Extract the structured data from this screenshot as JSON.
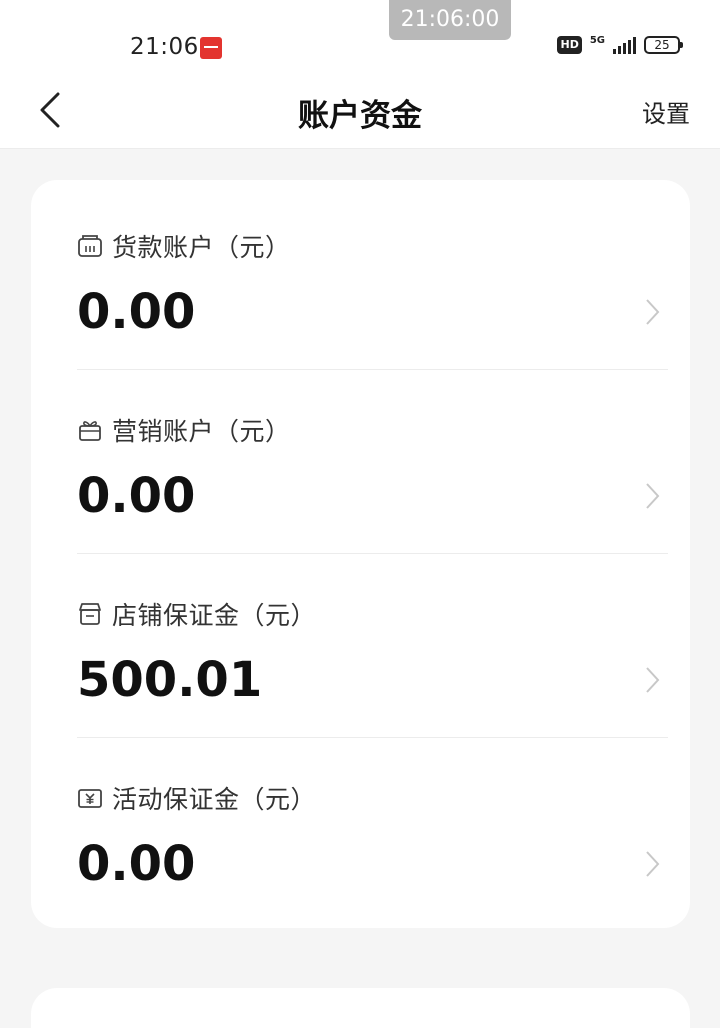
{
  "status_bar": {
    "time": "21:06",
    "overlay_time": "21:06:00",
    "hd": "HD",
    "network": "5G",
    "battery": "25"
  },
  "header": {
    "title": "账户资金",
    "settings": "设置"
  },
  "accounts": [
    {
      "label": "货款账户（元）",
      "value": "0.00",
      "icon": "wallet-icon"
    },
    {
      "label": "营销账户（元）",
      "value": "0.00",
      "icon": "gift-icon"
    },
    {
      "label": "店铺保证金（元）",
      "value": "500.01",
      "icon": "store-icon"
    },
    {
      "label": "活动保证金（元）",
      "value": "0.00",
      "icon": "yuan-ticket-icon"
    }
  ]
}
